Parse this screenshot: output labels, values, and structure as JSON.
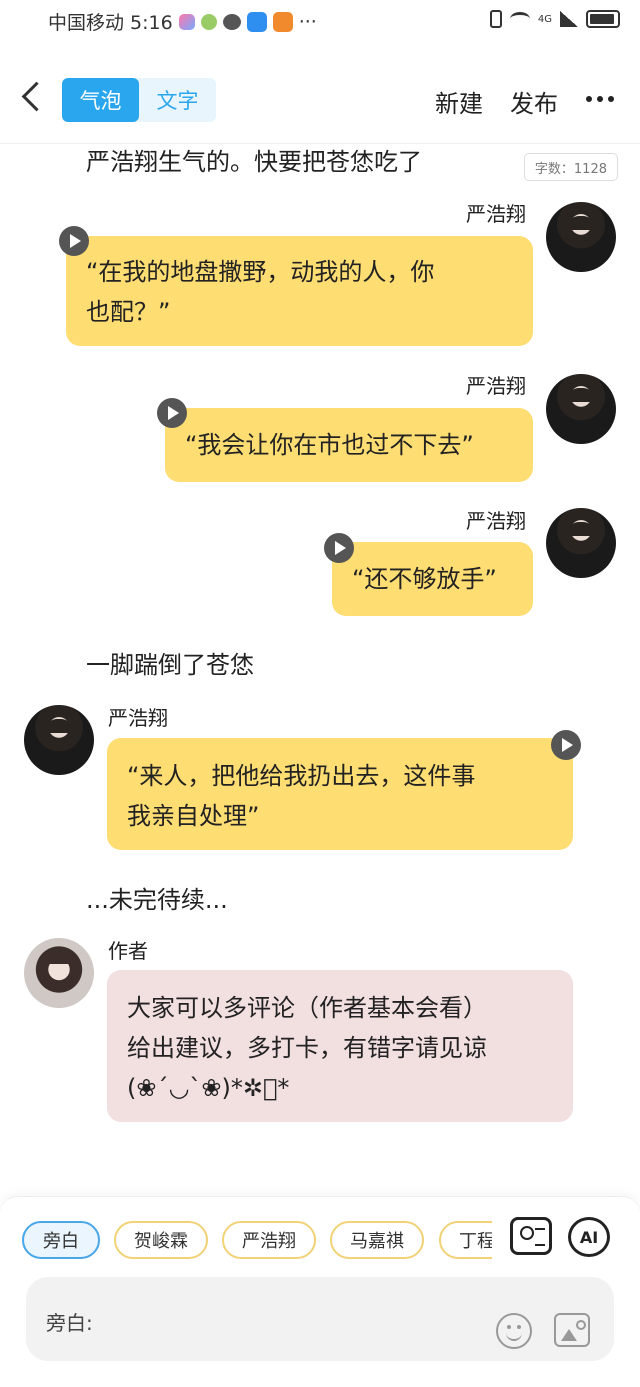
{
  "status_bar": {
    "carrier_time": "中国移动 5:16",
    "dots": "···",
    "network": "4G"
  },
  "header": {
    "tabs": [
      "气泡",
      "文字"
    ],
    "new_label": "新建",
    "publish_label": "发布"
  },
  "content": {
    "top_narration": "严浩翔生气的。快要把苍恷吃了",
    "word_count": "字数：1128",
    "messages": [
      {
        "speaker": "严浩翔",
        "line1": "“在我的地盘撒野，动我的人，你",
        "line2": "也配？”"
      },
      {
        "speaker": "严浩翔",
        "line1": "“我会让你在市也过不下去”"
      },
      {
        "speaker": "严浩翔",
        "line1": "“还不够放手”"
      },
      {
        "speaker": "严浩翔",
        "line1": "“来人，把他给我扔出去，这件事",
        "line2": "我亲自处理”"
      },
      {
        "speaker": "作者",
        "line1": "大家可以多评论（作者基本会看）",
        "line2": "给出建议，多打卡，有错字请见谅",
        "line3": "(❀´◡`❀)*✲ﾟ*"
      }
    ],
    "narration_2": "一脚踹倒了苍恷",
    "narration_3": "...未完待续..."
  },
  "bottom": {
    "chips": [
      "旁白",
      "贺峻霖",
      "严浩翔",
      "马嘉祺",
      "丁程鑫"
    ],
    "ai_label": "AI",
    "input_label": "旁白:"
  },
  "colors": {
    "accent_blue": "#2aa6ee",
    "bubble_yellow": "#fedd73",
    "bubble_pink": "#f2dfe0"
  }
}
